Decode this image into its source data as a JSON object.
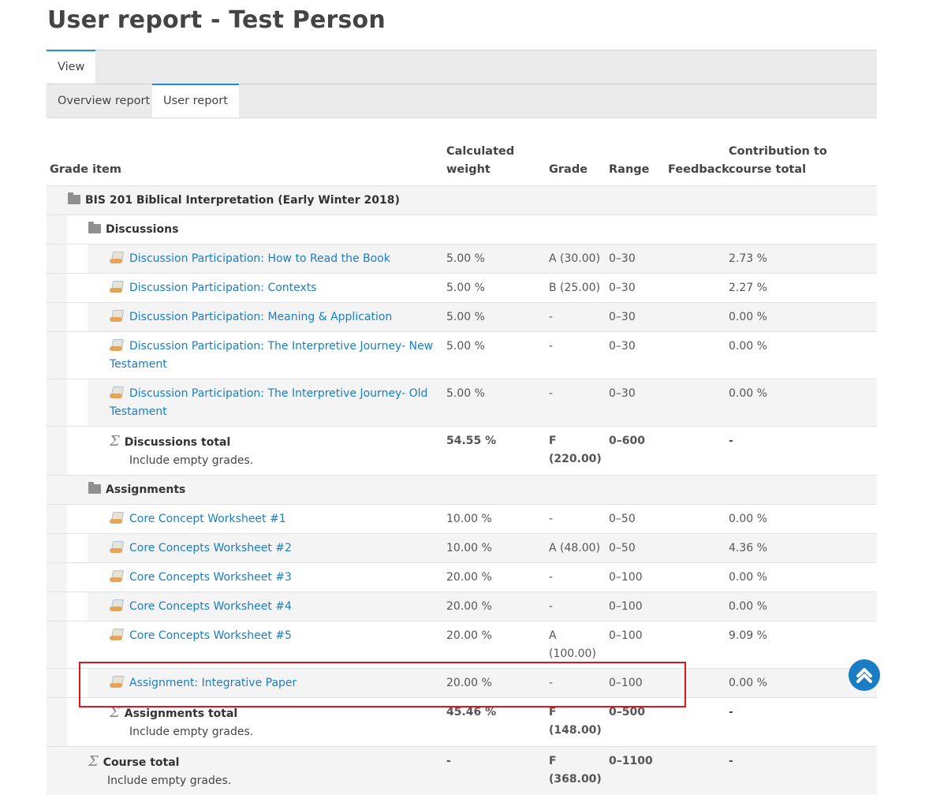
{
  "title": "User report - Test Person",
  "tabs_row1": [
    {
      "label": "View"
    }
  ],
  "tabs_row2": [
    {
      "label": "Overview report"
    },
    {
      "label": "User report"
    }
  ],
  "columns": {
    "grade_item": "Grade item",
    "weight": "Calculated weight",
    "grade": "Grade",
    "range": "Range",
    "feedback": "Feedback",
    "contribution": "Contribution to course total"
  },
  "course": "BIS 201 Biblical Interpretation (Early Winter 2018)",
  "discussions": {
    "label": "Discussions",
    "items": [
      {
        "name": "Discussion Participation: How to Read the Book",
        "weight": "5.00 %",
        "grade": "A (30.00)",
        "range": "0–30",
        "contribution": "2.73 %"
      },
      {
        "name": "Discussion Participation: Contexts",
        "weight": "5.00 %",
        "grade": "B (25.00)",
        "range": "0–30",
        "contribution": "2.27 %"
      },
      {
        "name": "Discussion Participation: Meaning & Application",
        "weight": "5.00 %",
        "grade": "-",
        "range": "0–30",
        "contribution": "0.00 %"
      },
      {
        "name": "Discussion Participation: The Interpretive Journey- New Testament",
        "weight": "5.00 %",
        "grade": "-",
        "range": "0–30",
        "contribution": "0.00 %"
      },
      {
        "name": "Discussion Participation: The Interpretive Journey- Old Testament",
        "weight": "5.00 %",
        "grade": "-",
        "range": "0–30",
        "contribution": "0.00 %"
      }
    ],
    "total": {
      "label": "Discussions total",
      "sub": "Include empty grades.",
      "weight": "54.55 %",
      "grade_letter": "F",
      "grade_value": "(220.00)",
      "range": "0–600",
      "contribution": "-"
    }
  },
  "assignments": {
    "label": "Assignments",
    "items": [
      {
        "name": "Core Concept Worksheet #1",
        "weight": "10.00 %",
        "grade": "-",
        "range": "0–50",
        "contribution": "0.00 %"
      },
      {
        "name": "Core Concepts Worksheet #2",
        "weight": "10.00 %",
        "grade": "A (48.00)",
        "range": "0–50",
        "contribution": "4.36 %"
      },
      {
        "name": "Core Concepts Worksheet #3",
        "weight": "20.00 %",
        "grade": "-",
        "range": "0–100",
        "contribution": "0.00 %"
      },
      {
        "name": "Core Concepts Worksheet #4",
        "weight": "20.00 %",
        "grade": "-",
        "range": "0–100",
        "contribution": "0.00 %"
      },
      {
        "name": "Core Concepts Worksheet #5",
        "weight": "20.00 %",
        "grade": "A (100.00)",
        "range": "0–100",
        "contribution": "9.09 %"
      },
      {
        "name": "Assignment: Integrative Paper",
        "weight": "20.00 %",
        "grade": "-",
        "range": "0–100",
        "contribution": "0.00 %"
      }
    ],
    "total": {
      "label": "Assignments total",
      "sub": "Include empty grades.",
      "weight": "45.46 %",
      "grade_letter": "F",
      "grade_value": "(148.00)",
      "range": "0–500",
      "contribution": "-"
    }
  },
  "course_total": {
    "label": "Course total",
    "sub": "Include empty grades.",
    "weight": "-",
    "grade_letter": "F",
    "grade_value": "(368.00)",
    "range": "0–1100",
    "contribution": "-"
  },
  "colors": {
    "link": "#1a7dc4",
    "highlight": "#e0141b",
    "tab_accent": "#1f8ad6"
  }
}
